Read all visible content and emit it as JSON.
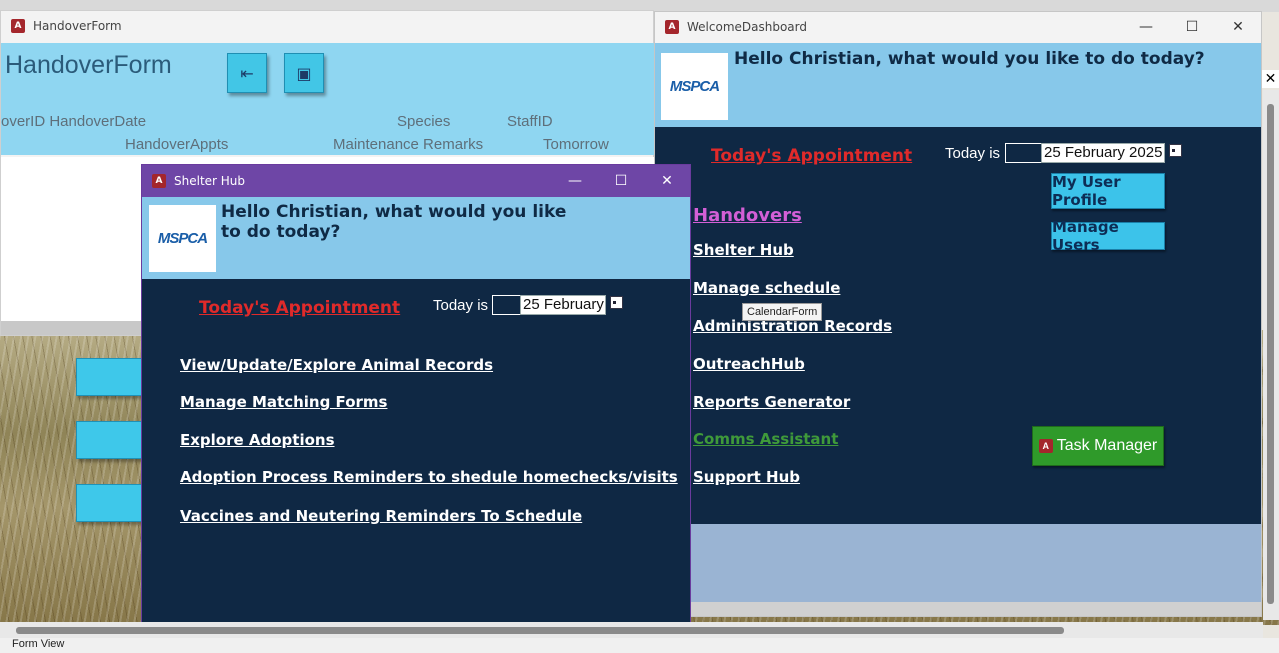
{
  "handover": {
    "window_title": "HandoverForm",
    "form_title": "HandoverForm",
    "columns_row1": [
      "overID HandoverDate",
      "Species",
      "StaffID"
    ],
    "columns_row2": [
      "HandoverAppts",
      "Maintenance Remarks",
      "Tomorrow"
    ]
  },
  "welcome": {
    "window_title": "WelcomeDashboard",
    "greeting": "Hello Christian, what would you like to do today?",
    "logo_text": "MSPCA",
    "todays_appointment": "Today's Appointment",
    "today_is": "Today is",
    "date_value": "25 February 2025",
    "links": {
      "handovers": "Handovers",
      "shelter_hub": "Shelter Hub",
      "manage_schedule": "Manage schedule",
      "administration_records": "Administration Records",
      "outreach_hub": "OutreachHub",
      "reports_generator": "Reports Generator",
      "comms_assistant": "Comms Assistant",
      "support_hub": "Support Hub"
    },
    "buttons": {
      "my_user_profile": "My User Profile",
      "manage_users": "Manage Users",
      "task_manager": "Task Manager"
    },
    "tooltip": "CalendarForm",
    "colors": {
      "handovers_link": "#d35fd6",
      "comms_link": "#3f9a3a",
      "task_button": "#2f9a2a"
    }
  },
  "hub": {
    "window_title": "Shelter Hub",
    "greeting": "Hello Christian, what would you like to do today?",
    "logo_text": "MSPCA",
    "todays_appointment": "Today's Appointment",
    "today_is": "Today is",
    "date_value": "25 February",
    "links": [
      "View/Update/Explore Animal Records",
      "Manage Matching Forms",
      "Explore Adoptions",
      "Adoption Process Reminders to shedule homechecks/visits",
      "Vaccines and Neutering Reminders To Schedule"
    ]
  },
  "status_bar": {
    "text": "Form View"
  }
}
